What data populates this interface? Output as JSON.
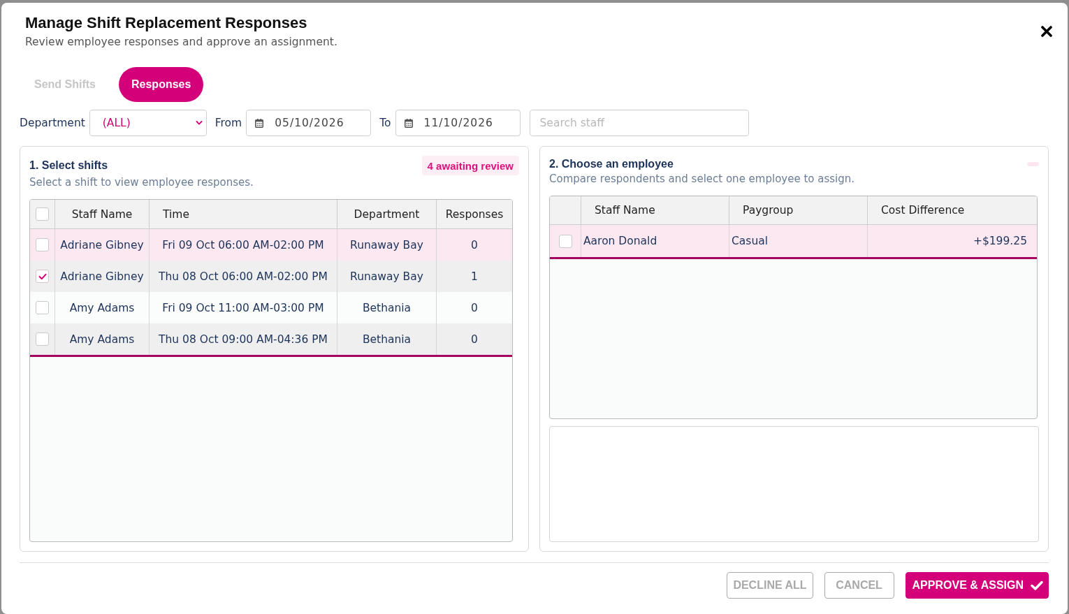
{
  "dialog": {
    "title": "Manage Shift Replacement Responses",
    "subtitle": "Review employee responses and approve an assignment."
  },
  "tabs": [
    {
      "label": "Send Shifts",
      "selected": false
    },
    {
      "label": "Responses",
      "selected": true
    }
  ],
  "filters": {
    "department": {
      "label": "Department",
      "value": "(ALL)"
    },
    "from": {
      "label": "From",
      "value": "05/10/2026"
    },
    "to": {
      "label": "To",
      "value": "11/10/2026"
    },
    "search": {
      "placeholder": "Search staff"
    }
  },
  "shifts_panel": {
    "title": "1. Select shifts",
    "badge": "4 awaiting review",
    "subtitle": "Select a shift to view employee responses.",
    "table": {
      "select_all_checked": false,
      "columns": [
        "Staff Name",
        "Time",
        "Department",
        "Responses"
      ],
      "rows": [
        {
          "checked": false,
          "highlighted": true,
          "cells": [
            "Adriane Gibney",
            "Fri 09 Oct 06:00 AM-02:00 PM",
            "Runaway Bay",
            "0"
          ]
        },
        {
          "checked": true,
          "highlighted": false,
          "cells": [
            "Adriane Gibney",
            "Thu 08 Oct 06:00 AM-02:00 PM",
            "Runaway Bay",
            "1"
          ]
        },
        {
          "checked": false,
          "highlighted": false,
          "cells": [
            "Amy Adams",
            "Fri 09 Oct 11:00 AM-03:00 PM",
            "Bethania",
            "0"
          ]
        },
        {
          "checked": false,
          "highlighted": false,
          "cells": [
            "Amy Adams",
            "Thu 08 Oct 09:00 AM-04:36 PM",
            "Bethania",
            "0"
          ]
        }
      ]
    }
  },
  "employees_panel": {
    "title": "2. Choose an employee",
    "subtitle": "Compare respondents and select one employee to assign.",
    "table": {
      "columns": [
        "Staff Name",
        "Paygroup",
        "Cost Difference"
      ],
      "rows": [
        {
          "checked": false,
          "highlighted": true,
          "cells": [
            "Aaron Donald",
            "Casual",
            "+$199.25"
          ]
        }
      ]
    }
  },
  "buttons": [
    {
      "label": "DECLINE ALL",
      "kind": "outline"
    },
    {
      "label": "CANCEL",
      "kind": "outline"
    },
    {
      "label": "APPROVE & ASSIGN",
      "kind": "primary"
    }
  ]
}
